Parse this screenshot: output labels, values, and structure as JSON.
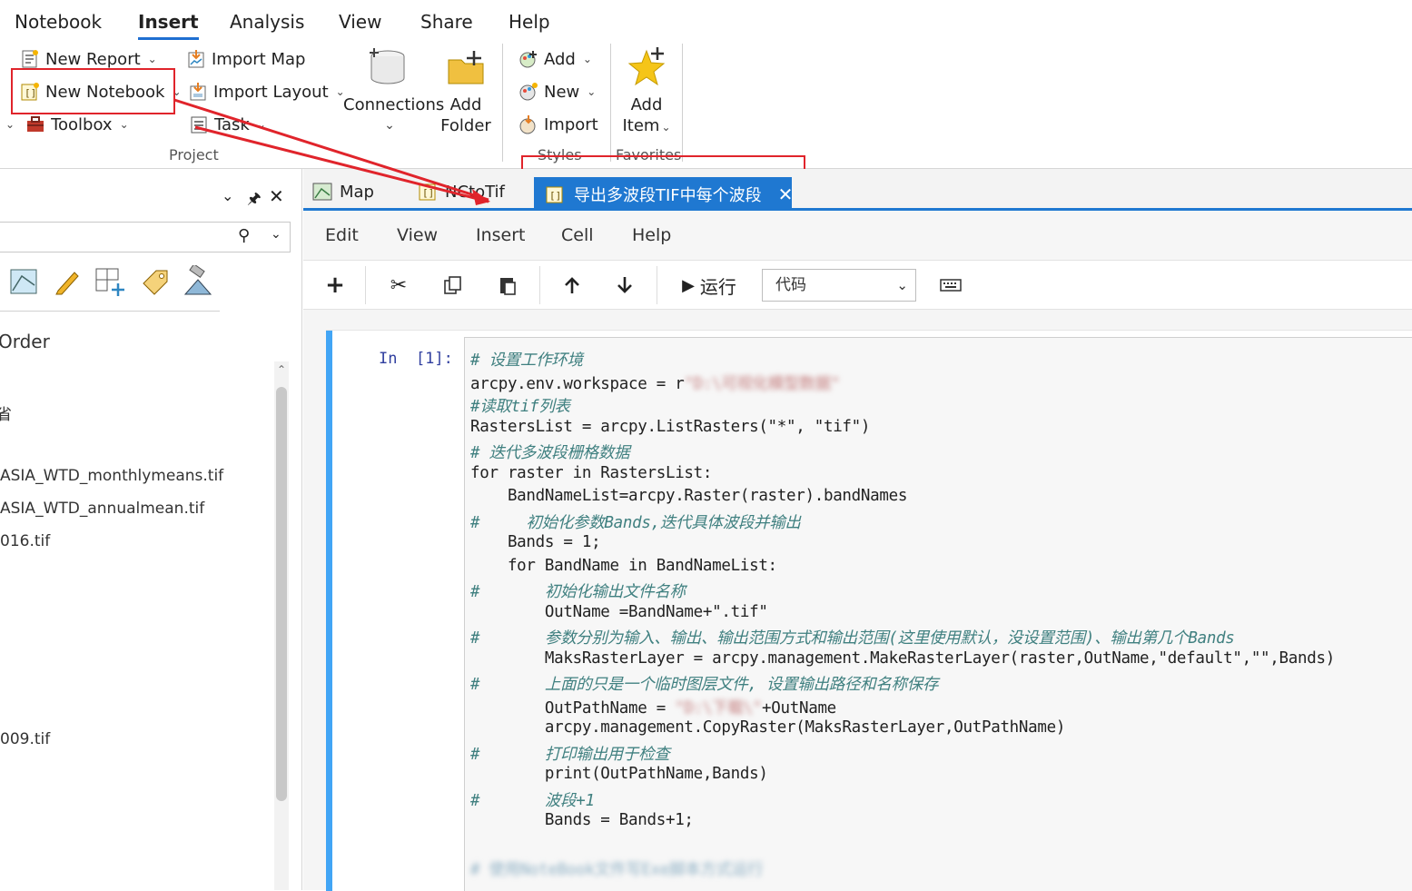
{
  "ribbon": {
    "tabs": [
      "Notebook",
      "Insert",
      "Analysis",
      "View",
      "Share",
      "Help"
    ],
    "active_tab": "Insert",
    "project": {
      "new_report": "New Report",
      "new_notebook": "New Notebook",
      "toolbox": "Toolbox",
      "import_map": "Import Map",
      "import_layout": "Import Layout",
      "task": "Task",
      "connections": "Connections",
      "add_folder_1": "Add",
      "add_folder_2": "Folder",
      "label": "Project"
    },
    "styles": {
      "add": "Add",
      "new": "New",
      "import": "Import",
      "label": "Styles"
    },
    "favorites": {
      "add_item_1": "Add",
      "add_item_2": "Item",
      "label": "Favorites"
    }
  },
  "left_pane": {
    "heading": "Order",
    "items": [
      "省",
      "ASIA_WTD_monthlymeans.tif",
      "ASIA_WTD_annualmean.tif",
      "016.tif",
      "009.tif"
    ]
  },
  "doc_tabs": {
    "tab_map": "Map",
    "tab_nctotif": "NCtoTif",
    "tab_active": "导出多波段TIF中每个波段"
  },
  "notebook": {
    "menu": [
      "Edit",
      "View",
      "Insert",
      "Cell",
      "Help"
    ],
    "toolbar": {
      "run_label": "运行",
      "cell_type": "代码"
    },
    "prompt": "In  [1]:",
    "code_lines": [
      "# 设置工作环境",
      "arcpy.env.workspace = r",
      "#读取tif列表",
      "RastersList = arcpy.ListRasters(\"*\", \"tif\")",
      "# 迭代多波段栅格数据",
      "for raster in RastersList:",
      "    BandNameList=arcpy.Raster(raster).bandNames",
      "#     初始化参数Bands,迭代具体波段并输出",
      "    Bands = 1;",
      "    for BandName in BandNameList:",
      "#       初始化输出文件名称",
      "        OutName =BandName+\".tif\"",
      "#       参数分别为输入、输出、输出范围方式和输出范围(这里使用默认，没设置范围)、输出第几个Bands",
      "        MaksRasterLayer = arcpy.management.MakeRasterLayer(raster,OutName,\"default\",\"\",Bands)",
      "#       上面的只是一个临时图层文件, 设置输出路径和名称保存",
      "        OutPathName = ",
      "        arcpy.management.CopyRaster(MaksRasterLayer,OutPathName)",
      "#       打印输出用于检查",
      "        print(OutPathName,Bands)",
      "#       波段+1",
      "        Bands = Bands+1;"
    ]
  },
  "colors": {
    "accent": "#1f78d1",
    "annotation_red": "#e0242b",
    "cell_bar": "#42a5f5"
  }
}
